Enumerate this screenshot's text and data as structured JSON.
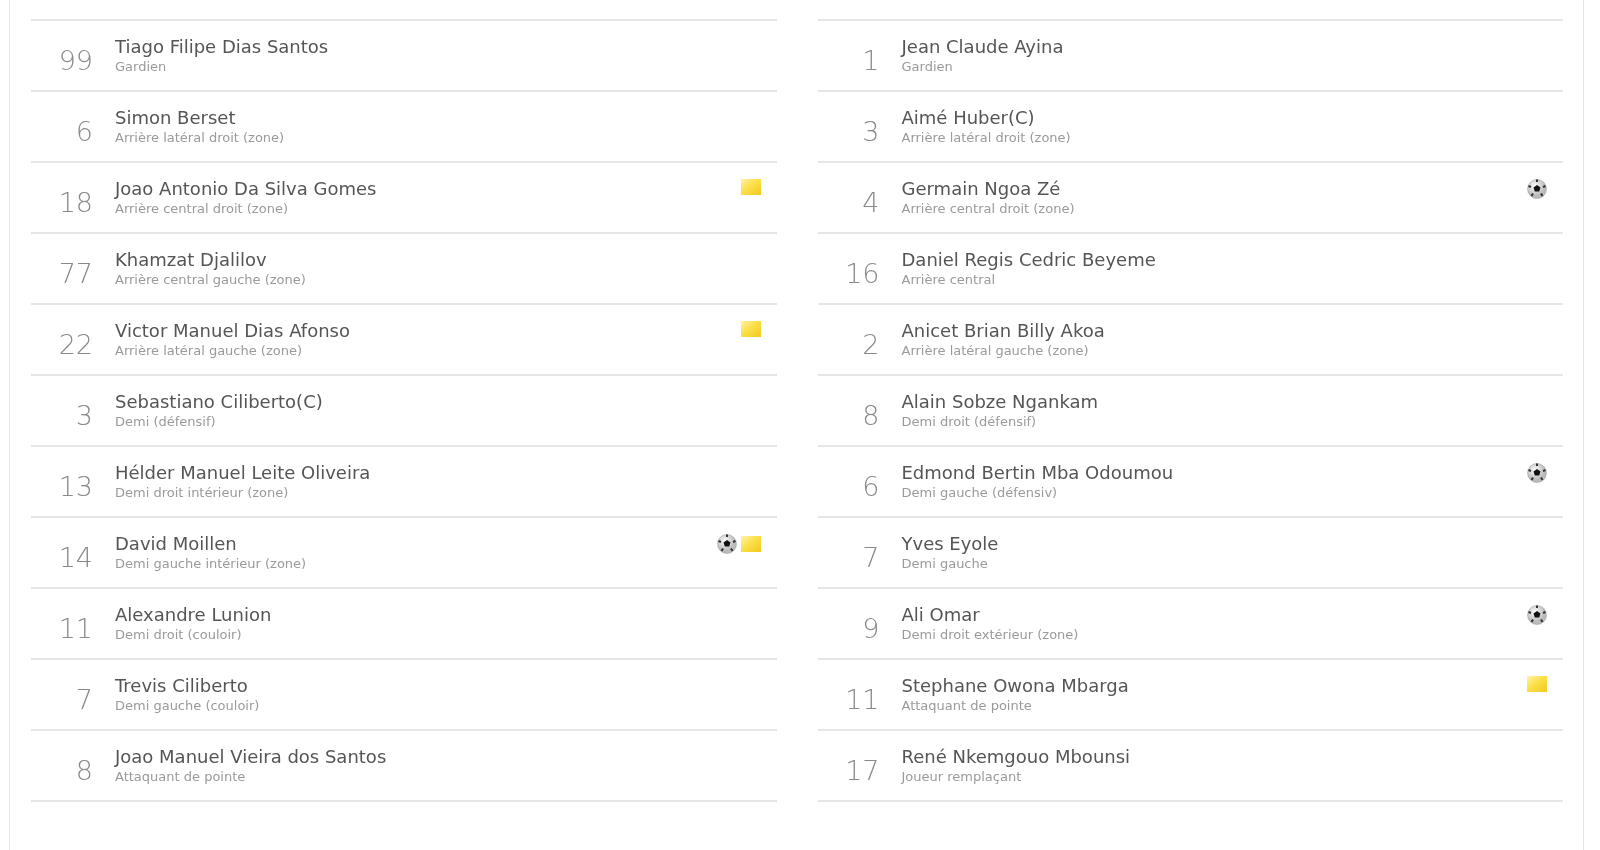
{
  "teams": [
    {
      "players": [
        {
          "number": "99",
          "name": "Tiago Filipe Dias Santos",
          "position": "Gardien"
        },
        {
          "number": "6",
          "name": "Simon Berset",
          "position": "Arrière latéral droit (zone)"
        },
        {
          "number": "18",
          "name": "Joao Antonio Da Silva Gomes",
          "position": "Arrière central droit (zone)",
          "events": [
            {
              "kind": "yellow_card"
            }
          ]
        },
        {
          "number": "77",
          "name": "Khamzat Djalilov",
          "position": "Arrière central gauche (zone)"
        },
        {
          "number": "22",
          "name": "Victor Manuel Dias Afonso",
          "position": "Arrière latéral gauche (zone)",
          "events": [
            {
              "kind": "yellow_card"
            }
          ]
        },
        {
          "number": "3",
          "name": "Sebastiano Ciliberto(C)",
          "position": "Demi (défensif)"
        },
        {
          "number": "13",
          "name": "Hélder Manuel Leite Oliveira",
          "position": "Demi droit intérieur (zone)"
        },
        {
          "number": "14",
          "name": "David Moillen",
          "position": "Demi gauche intérieur (zone)",
          "events": [
            {
              "kind": "goal"
            },
            {
              "kind": "yellow_card"
            }
          ]
        },
        {
          "number": "11",
          "name": "Alexandre Lunion",
          "position": "Demi droit (couloir)"
        },
        {
          "number": "7",
          "name": "Trevis Ciliberto",
          "position": "Demi gauche (couloir)"
        },
        {
          "number": "8",
          "name": "Joao Manuel Vieira dos Santos",
          "position": "Attaquant de pointe"
        }
      ]
    },
    {
      "players": [
        {
          "number": "1",
          "name": "Jean Claude Ayina",
          "position": "Gardien"
        },
        {
          "number": "3",
          "name": "Aimé Huber(C)",
          "position": "Arrière latéral droit (zone)"
        },
        {
          "number": "4",
          "name": "Germain Ngoa Zé",
          "position": "Arrière central droit (zone)",
          "events": [
            {
              "kind": "goal"
            }
          ]
        },
        {
          "number": "16",
          "name": "Daniel Regis Cedric Beyeme",
          "position": "Arrière central"
        },
        {
          "number": "2",
          "name": "Anicet Brian Billy Akoa",
          "position": "Arrière latéral gauche (zone)"
        },
        {
          "number": "8",
          "name": "Alain Sobze Ngankam",
          "position": "Demi droit (défensif)"
        },
        {
          "number": "6",
          "name": "Edmond Bertin Mba Odoumou",
          "position": "Demi gauche (défensiv)",
          "events": [
            {
              "kind": "goal"
            }
          ]
        },
        {
          "number": "7",
          "name": "Yves Eyole",
          "position": "Demi gauche"
        },
        {
          "number": "9",
          "name": "Ali Omar",
          "position": "Demi droit extérieur (zone)",
          "events": [
            {
              "kind": "goal"
            }
          ]
        },
        {
          "number": "11",
          "name": "Stephane Owona Mbarga",
          "position": "Attaquant de pointe",
          "events": [
            {
              "kind": "yellow_card"
            }
          ]
        },
        {
          "number": "17",
          "name": "René Nkemgouo Mbounsi",
          "position": "Joueur remplaçant"
        }
      ]
    }
  ]
}
